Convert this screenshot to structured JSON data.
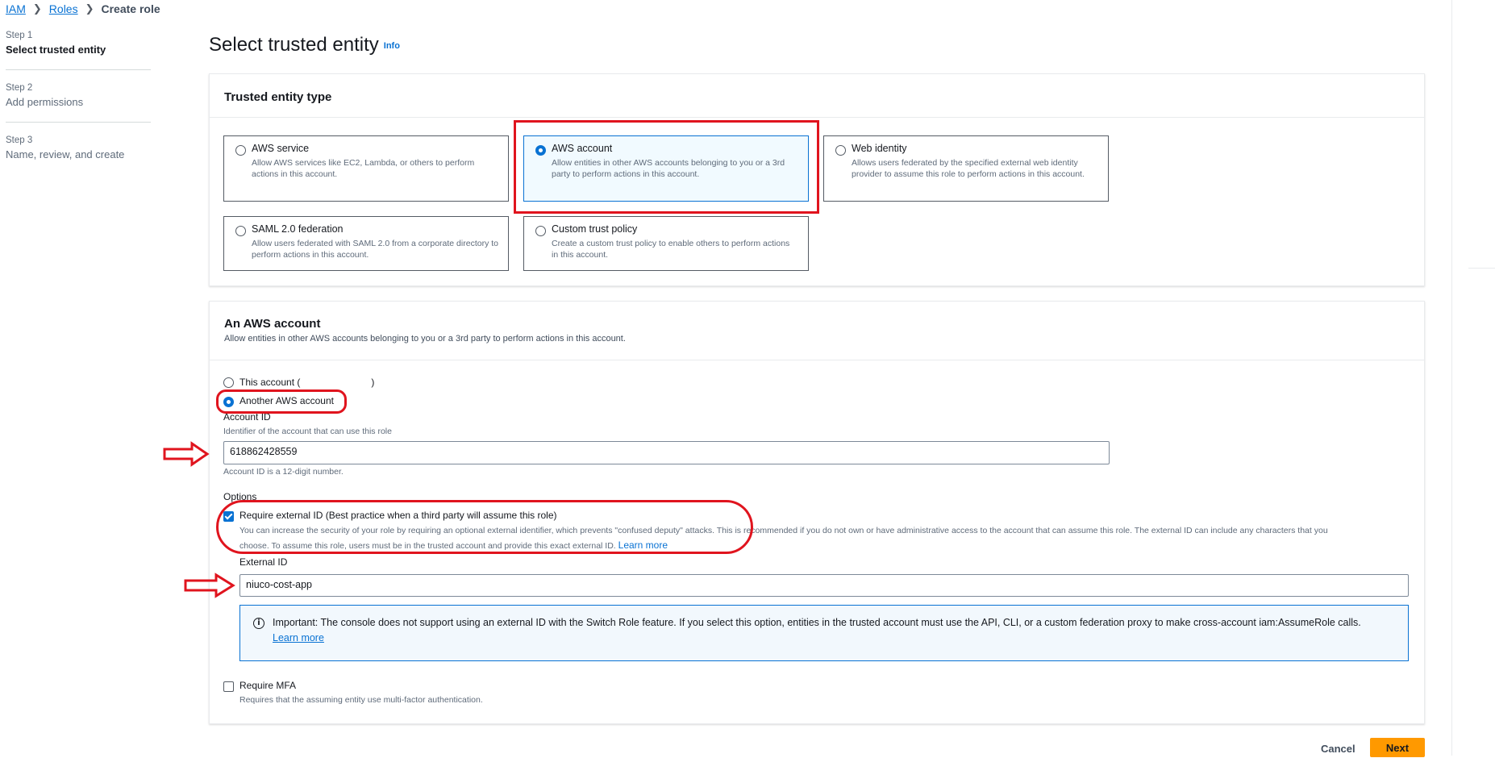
{
  "breadcrumb": {
    "iam": "IAM",
    "roles": "Roles",
    "current": "Create role"
  },
  "steps": [
    {
      "no": "Step 1",
      "title": "Select trusted entity"
    },
    {
      "no": "Step 2",
      "title": "Add permissions"
    },
    {
      "no": "Step 3",
      "title": "Name, review, and create"
    }
  ],
  "page": {
    "title": "Select trusted entity",
    "info": "Info"
  },
  "entity": {
    "heading": "Trusted entity type",
    "tiles": [
      {
        "label": "AWS service",
        "desc": "Allow AWS services like EC2, Lambda, or others to perform actions in this account."
      },
      {
        "label": "AWS account",
        "desc": "Allow entities in other AWS accounts belonging to you or a 3rd party to perform actions in this account."
      },
      {
        "label": "Web identity",
        "desc": "Allows users federated by the specified external web identity provider to assume this role to perform actions in this account."
      },
      {
        "label": "SAML 2.0 federation",
        "desc": "Allow users federated with SAML 2.0 from a corporate directory to perform actions in this account."
      },
      {
        "label": "Custom trust policy",
        "desc": "Create a custom trust policy to enable others to perform actions in this account."
      }
    ]
  },
  "account": {
    "heading": "An AWS account",
    "sub": "Allow entities in other AWS accounts belonging to you or a 3rd party to perform actions in this account.",
    "this_account": "This account (",
    "this_account_close": ")",
    "another_account": "Another AWS account",
    "account_id_label": "Account ID",
    "account_id_desc": "Identifier of the account that can use this role",
    "account_id_value": "618862428559",
    "account_id_hint": "Account ID is a 12-digit number.",
    "options_label": "Options",
    "ext_id_check_label": "Require external ID (Best practice when a third party will assume this role)",
    "ext_id_desc_1": "You can increase the security of your role by requiring an optional external identifier, which prevents \"confused deputy\" attacks. This is recommended if you do not own or have administrative access to the account that can assume this role. The external ID can include any characters that you",
    "ext_id_desc_2": "choose. To assume this role, users must be in the trusted account and provide this exact external ID.",
    "learn_more": "Learn more",
    "ext_id_label": "External ID",
    "ext_id_value": "niuco-cost-app",
    "alert_text": "Important: The console does not support using an external ID with the Switch Role feature. If you select this option, entities in the trusted account must use the API, CLI, or a custom federation proxy to make cross-account iam:AssumeRole calls.",
    "alert_link": "Learn more",
    "mfa_label": "Require MFA",
    "mfa_desc": "Requires that the assuming entity use multi-factor authentication."
  },
  "footer": {
    "cancel": "Cancel",
    "next": "Next"
  },
  "colors": {
    "accent": "#0972d3",
    "primary_button": "#ff9900",
    "annotation": "#e0141e"
  },
  "icons": {
    "breadcrumb_separator": "chevron-right-icon",
    "alert": "info-icon",
    "annotation_arrow": "red-arrow-icon"
  }
}
